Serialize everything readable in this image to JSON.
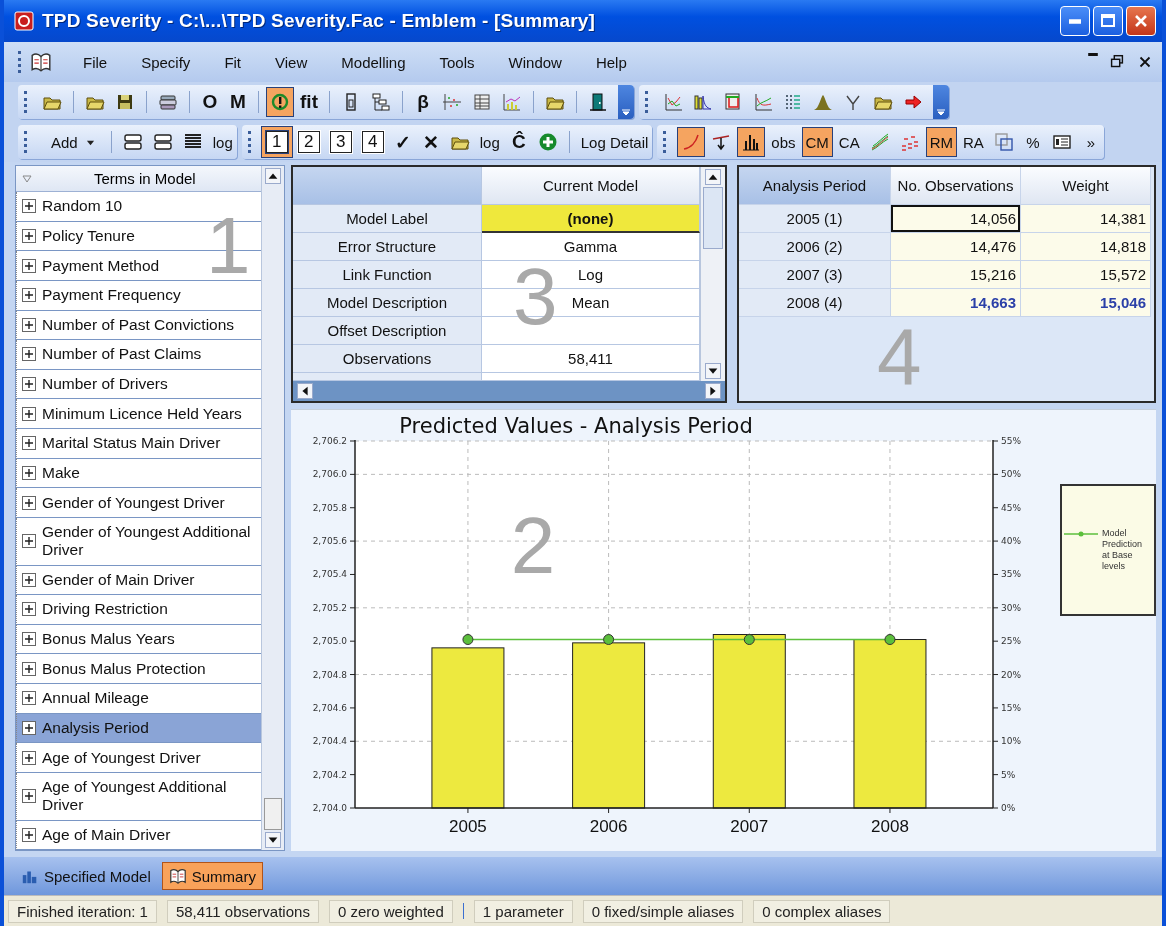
{
  "window": {
    "title": "TPD Severity - C:\\...\\TPD Severity.Fac - Emblem - [Summary]"
  },
  "menu": [
    {
      "label": "File"
    },
    {
      "label": "Specify"
    },
    {
      "label": "Fit"
    },
    {
      "label": "View"
    },
    {
      "label": "Modelling"
    },
    {
      "label": "Tools"
    },
    {
      "label": "Window"
    },
    {
      "label": "Help"
    }
  ],
  "toolbar_rows": [
    [
      {
        "overflow_button": true,
        "items": [
          {
            "kind": "icon",
            "pressed": false
          },
          {
            "kind": "sep"
          },
          {
            "kind": "icon",
            "pressed": false
          },
          {
            "kind": "icon",
            "pressed": false
          },
          {
            "kind": "sep"
          },
          {
            "kind": "icon",
            "pressed": false
          },
          {
            "kind": "sep"
          },
          {
            "kind": "strong",
            "label": "O",
            "pressed": false
          },
          {
            "kind": "strong",
            "label": "M",
            "pressed": false
          },
          {
            "kind": "sep"
          },
          {
            "kind": "icon",
            "pressed": true
          },
          {
            "kind": "strong",
            "label": "fit",
            "pressed": false
          },
          {
            "kind": "sep"
          },
          {
            "kind": "icon",
            "pressed": false
          },
          {
            "kind": "icon",
            "pressed": false
          },
          {
            "kind": "sep"
          },
          {
            "kind": "strong",
            "label": "β",
            "pressed": false
          },
          {
            "kind": "icon",
            "pressed": false
          },
          {
            "kind": "icon",
            "pressed": false
          },
          {
            "kind": "icon",
            "pressed": false
          },
          {
            "kind": "sep"
          },
          {
            "kind": "icon",
            "pressed": false
          },
          {
            "kind": "sep"
          },
          {
            "kind": "icon",
            "pressed": false
          }
        ]
      },
      {
        "overflow_button": true,
        "items": [
          {
            "kind": "icon",
            "pressed": false
          },
          {
            "kind": "icon",
            "pressed": false
          },
          {
            "kind": "icon",
            "pressed": false
          },
          {
            "kind": "icon",
            "pressed": false
          },
          {
            "kind": "icon",
            "pressed": false
          },
          {
            "kind": "icon",
            "pressed": false
          },
          {
            "kind": "icon",
            "pressed": false
          },
          {
            "kind": "icon",
            "pressed": false
          },
          {
            "kind": "icon",
            "pressed": false
          }
        ]
      }
    ],
    [
      {
        "overflow_button": false,
        "items": [
          {
            "kind": "dropdown",
            "label": "Add",
            "pressed": false
          },
          {
            "kind": "sep"
          },
          {
            "kind": "icon",
            "pressed": false
          },
          {
            "kind": "icon",
            "pressed": false
          },
          {
            "kind": "icon",
            "pressed": false
          },
          {
            "kind": "text",
            "label": "log",
            "pressed": false
          }
        ]
      },
      {
        "overflow_button": false,
        "items": [
          {
            "kind": "boxed",
            "label": "1",
            "pressed": true
          },
          {
            "kind": "boxed",
            "label": "2",
            "pressed": false
          },
          {
            "kind": "boxed",
            "label": "3",
            "pressed": false
          },
          {
            "kind": "boxed",
            "label": "4",
            "pressed": false
          },
          {
            "kind": "strong",
            "label": "✓",
            "pressed": false
          },
          {
            "kind": "strong",
            "label": "✕",
            "pressed": false
          },
          {
            "kind": "icon",
            "pressed": false
          },
          {
            "kind": "text",
            "label": "log",
            "pressed": false
          },
          {
            "kind": "strong",
            "label": "Ĉ",
            "pressed": false
          },
          {
            "kind": "icon",
            "pressed": false
          },
          {
            "kind": "sep"
          },
          {
            "kind": "text",
            "label": "Log Detail",
            "pressed": false
          }
        ]
      },
      {
        "overflow_button": false,
        "items": [
          {
            "kind": "icon",
            "pressed": true
          },
          {
            "kind": "icon",
            "pressed": false
          },
          {
            "kind": "icon",
            "pressed": true
          },
          {
            "kind": "text",
            "label": "obs",
            "pressed": false
          },
          {
            "kind": "text",
            "label": "CM",
            "pressed": true
          },
          {
            "kind": "text",
            "label": "CA",
            "pressed": false
          },
          {
            "kind": "icon",
            "pressed": false
          },
          {
            "kind": "icon",
            "pressed": false
          },
          {
            "kind": "text",
            "label": "RM",
            "pressed": true
          },
          {
            "kind": "text",
            "label": "RA",
            "pressed": false
          },
          {
            "kind": "icon",
            "pressed": false
          },
          {
            "kind": "text",
            "label": "%",
            "pressed": false
          },
          {
            "kind": "icon",
            "pressed": false
          },
          {
            "kind": "text",
            "label": "»",
            "pressed": false
          }
        ]
      }
    ]
  ],
  "terms_panel": {
    "header": "Terms in Model",
    "panel_number": "1",
    "items": [
      {
        "label": "Random 10",
        "expanded": false,
        "selected": false
      },
      {
        "label": "Policy Tenure",
        "expanded": false,
        "selected": false
      },
      {
        "label": "Payment Method",
        "expanded": false,
        "selected": false
      },
      {
        "label": "Payment Frequency",
        "expanded": false,
        "selected": false
      },
      {
        "label": "Number of Past Convictions",
        "expanded": false,
        "selected": false
      },
      {
        "label": "Number of Past Claims",
        "expanded": false,
        "selected": false
      },
      {
        "label": "Number of Drivers",
        "expanded": false,
        "selected": false
      },
      {
        "label": "Minimum Licence Held Years",
        "expanded": false,
        "selected": false
      },
      {
        "label": "Marital Status Main Driver",
        "expanded": false,
        "selected": false
      },
      {
        "label": "Make",
        "expanded": false,
        "selected": false
      },
      {
        "label": "Gender of Youngest Driver",
        "expanded": false,
        "selected": false
      },
      {
        "label": "Gender of Youngest Additional Driver",
        "expanded": false,
        "selected": false
      },
      {
        "label": "Gender of Main Driver",
        "expanded": false,
        "selected": false
      },
      {
        "label": "Driving Restriction",
        "expanded": false,
        "selected": false
      },
      {
        "label": "Bonus Malus Years",
        "expanded": false,
        "selected": false
      },
      {
        "label": "Bonus Malus Protection",
        "expanded": false,
        "selected": false
      },
      {
        "label": "Annual Mileage",
        "expanded": false,
        "selected": false
      },
      {
        "label": "Analysis Period",
        "expanded": false,
        "selected": true
      },
      {
        "label": "Age of Youngest Driver",
        "expanded": false,
        "selected": false
      },
      {
        "label": "Age of Youngest Additional Driver",
        "expanded": false,
        "selected": false
      },
      {
        "label": "Age of Main Driver",
        "expanded": false,
        "selected": false
      }
    ]
  },
  "model_table": {
    "header": "Current Model",
    "panel_number": "3",
    "rows": [
      {
        "label": "Model Label",
        "value": "(none)",
        "highlighted": true
      },
      {
        "label": "Error Structure",
        "value": "Gamma",
        "highlighted": false
      },
      {
        "label": "Link Function",
        "value": "Log",
        "highlighted": false
      },
      {
        "label": "Model Description",
        "value": "Mean",
        "highlighted": false
      },
      {
        "label": "Offset Description",
        "highlighted": false
      },
      {
        "label": "Observations",
        "value": "58,411",
        "highlighted": false
      }
    ]
  },
  "period_table": {
    "columns": [
      "Analysis Period",
      "No. Observations",
      "Weight"
    ],
    "panel_number": "4",
    "rows": [
      {
        "period": "2005 (1)",
        "observations": "14,056",
        "weight": "14,381",
        "focused": true,
        "emphasized": false
      },
      {
        "period": "2006 (2)",
        "observations": "14,476",
        "weight": "14,818",
        "focused": false,
        "emphasized": false
      },
      {
        "period": "2007 (3)",
        "observations": "15,216",
        "weight": "15,572",
        "focused": false,
        "emphasized": false
      },
      {
        "period": "2008 (4)",
        "observations": "14,663",
        "weight": "15,046",
        "focused": false,
        "emphasized": true
      }
    ]
  },
  "chart": {
    "panel_number": "2",
    "right_axis_labels": [
      "55%",
      "50%",
      "45%",
      "40%",
      "35%",
      "30%",
      "25%",
      "20%",
      "15%",
      "10%",
      "5%",
      "0%"
    ],
    "chart_data": {
      "type": "bar",
      "title": "Predicted Values - Analysis Period",
      "categories": [
        "2005",
        "2006",
        "2007",
        "2008"
      ],
      "series": [
        {
          "color": "#ede93f",
          "values": [
            2704.96,
            2704.99,
            2705.04,
            2705.01
          ]
        },
        {
          "name": "Model Prediction at Base levels",
          "type": "line",
          "marker": "circle",
          "color": "#5cbf3c",
          "values": [
            2705.01,
            2705.01,
            2705.01,
            2705.01
          ]
        }
      ],
      "ylim": [
        2704.0,
        2706.2
      ],
      "grid": true,
      "yticks": [
        {
          "value": 2704.0,
          "label": "2,704.0"
        },
        {
          "value": 2704.2,
          "label": "2,704.2"
        },
        {
          "value": 2704.4,
          "label": "2,704.4"
        },
        {
          "value": 2704.6,
          "label": "2,704.6"
        },
        {
          "value": 2704.8,
          "label": "2,704.8"
        },
        {
          "value": 2705.0,
          "label": "2,705.0"
        },
        {
          "value": 2705.2,
          "label": "2,705.2"
        },
        {
          "value": 2705.4,
          "label": "2,705.4"
        },
        {
          "value": 2705.6,
          "label": "2,705.6"
        },
        {
          "value": 2705.8,
          "label": "2,705.8"
        },
        {
          "value": 2706.0,
          "label": "2,706.0"
        },
        {
          "value": 2706.2,
          "label": "2,706.2"
        }
      ]
    }
  },
  "view_tabs": [
    {
      "label": "Specified Model",
      "selected": false
    },
    {
      "label": "Summary",
      "selected": true
    }
  ],
  "status_bar": [
    "Finished iteration: 1",
    "58,411 observations",
    "0 zero weighted",
    "1 parameter",
    "0 fixed/simple aliases",
    "0 complex aliases"
  ]
}
